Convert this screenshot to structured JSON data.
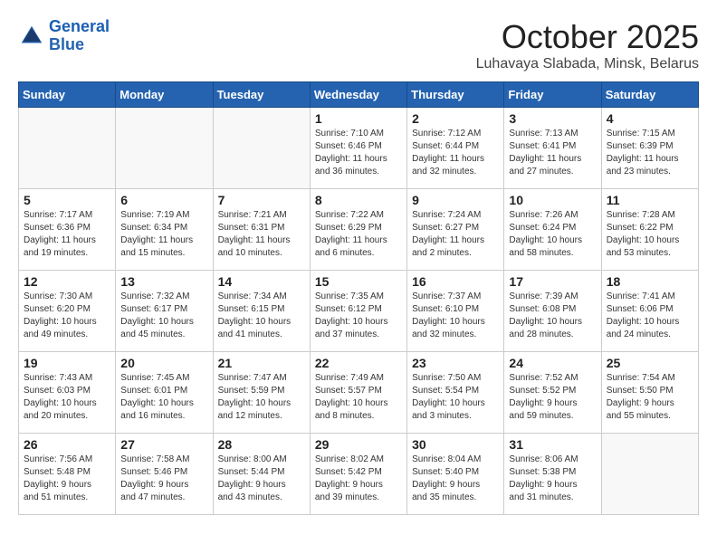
{
  "header": {
    "logo_line1": "General",
    "logo_line2": "Blue",
    "title": "October 2025",
    "subtitle": "Luhavaya Slabada, Minsk, Belarus"
  },
  "days_of_week": [
    "Sunday",
    "Monday",
    "Tuesday",
    "Wednesday",
    "Thursday",
    "Friday",
    "Saturday"
  ],
  "weeks": [
    [
      {
        "day": "",
        "info": ""
      },
      {
        "day": "",
        "info": ""
      },
      {
        "day": "",
        "info": ""
      },
      {
        "day": "1",
        "info": "Sunrise: 7:10 AM\nSunset: 6:46 PM\nDaylight: 11 hours\nand 36 minutes."
      },
      {
        "day": "2",
        "info": "Sunrise: 7:12 AM\nSunset: 6:44 PM\nDaylight: 11 hours\nand 32 minutes."
      },
      {
        "day": "3",
        "info": "Sunrise: 7:13 AM\nSunset: 6:41 PM\nDaylight: 11 hours\nand 27 minutes."
      },
      {
        "day": "4",
        "info": "Sunrise: 7:15 AM\nSunset: 6:39 PM\nDaylight: 11 hours\nand 23 minutes."
      }
    ],
    [
      {
        "day": "5",
        "info": "Sunrise: 7:17 AM\nSunset: 6:36 PM\nDaylight: 11 hours\nand 19 minutes."
      },
      {
        "day": "6",
        "info": "Sunrise: 7:19 AM\nSunset: 6:34 PM\nDaylight: 11 hours\nand 15 minutes."
      },
      {
        "day": "7",
        "info": "Sunrise: 7:21 AM\nSunset: 6:31 PM\nDaylight: 11 hours\nand 10 minutes."
      },
      {
        "day": "8",
        "info": "Sunrise: 7:22 AM\nSunset: 6:29 PM\nDaylight: 11 hours\nand 6 minutes."
      },
      {
        "day": "9",
        "info": "Sunrise: 7:24 AM\nSunset: 6:27 PM\nDaylight: 11 hours\nand 2 minutes."
      },
      {
        "day": "10",
        "info": "Sunrise: 7:26 AM\nSunset: 6:24 PM\nDaylight: 10 hours\nand 58 minutes."
      },
      {
        "day": "11",
        "info": "Sunrise: 7:28 AM\nSunset: 6:22 PM\nDaylight: 10 hours\nand 53 minutes."
      }
    ],
    [
      {
        "day": "12",
        "info": "Sunrise: 7:30 AM\nSunset: 6:20 PM\nDaylight: 10 hours\nand 49 minutes."
      },
      {
        "day": "13",
        "info": "Sunrise: 7:32 AM\nSunset: 6:17 PM\nDaylight: 10 hours\nand 45 minutes."
      },
      {
        "day": "14",
        "info": "Sunrise: 7:34 AM\nSunset: 6:15 PM\nDaylight: 10 hours\nand 41 minutes."
      },
      {
        "day": "15",
        "info": "Sunrise: 7:35 AM\nSunset: 6:12 PM\nDaylight: 10 hours\nand 37 minutes."
      },
      {
        "day": "16",
        "info": "Sunrise: 7:37 AM\nSunset: 6:10 PM\nDaylight: 10 hours\nand 32 minutes."
      },
      {
        "day": "17",
        "info": "Sunrise: 7:39 AM\nSunset: 6:08 PM\nDaylight: 10 hours\nand 28 minutes."
      },
      {
        "day": "18",
        "info": "Sunrise: 7:41 AM\nSunset: 6:06 PM\nDaylight: 10 hours\nand 24 minutes."
      }
    ],
    [
      {
        "day": "19",
        "info": "Sunrise: 7:43 AM\nSunset: 6:03 PM\nDaylight: 10 hours\nand 20 minutes."
      },
      {
        "day": "20",
        "info": "Sunrise: 7:45 AM\nSunset: 6:01 PM\nDaylight: 10 hours\nand 16 minutes."
      },
      {
        "day": "21",
        "info": "Sunrise: 7:47 AM\nSunset: 5:59 PM\nDaylight: 10 hours\nand 12 minutes."
      },
      {
        "day": "22",
        "info": "Sunrise: 7:49 AM\nSunset: 5:57 PM\nDaylight: 10 hours\nand 8 minutes."
      },
      {
        "day": "23",
        "info": "Sunrise: 7:50 AM\nSunset: 5:54 PM\nDaylight: 10 hours\nand 3 minutes."
      },
      {
        "day": "24",
        "info": "Sunrise: 7:52 AM\nSunset: 5:52 PM\nDaylight: 9 hours\nand 59 minutes."
      },
      {
        "day": "25",
        "info": "Sunrise: 7:54 AM\nSunset: 5:50 PM\nDaylight: 9 hours\nand 55 minutes."
      }
    ],
    [
      {
        "day": "26",
        "info": "Sunrise: 7:56 AM\nSunset: 5:48 PM\nDaylight: 9 hours\nand 51 minutes."
      },
      {
        "day": "27",
        "info": "Sunrise: 7:58 AM\nSunset: 5:46 PM\nDaylight: 9 hours\nand 47 minutes."
      },
      {
        "day": "28",
        "info": "Sunrise: 8:00 AM\nSunset: 5:44 PM\nDaylight: 9 hours\nand 43 minutes."
      },
      {
        "day": "29",
        "info": "Sunrise: 8:02 AM\nSunset: 5:42 PM\nDaylight: 9 hours\nand 39 minutes."
      },
      {
        "day": "30",
        "info": "Sunrise: 8:04 AM\nSunset: 5:40 PM\nDaylight: 9 hours\nand 35 minutes."
      },
      {
        "day": "31",
        "info": "Sunrise: 8:06 AM\nSunset: 5:38 PM\nDaylight: 9 hours\nand 31 minutes."
      },
      {
        "day": "",
        "info": ""
      }
    ]
  ]
}
